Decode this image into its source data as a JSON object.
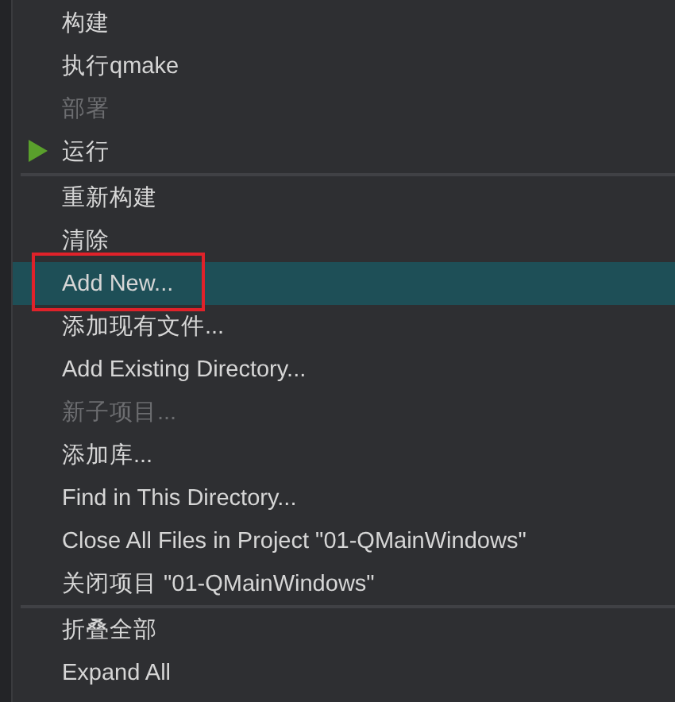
{
  "menu": {
    "groups": [
      {
        "items": [
          {
            "label": "构建",
            "disabled": false,
            "selected": false
          },
          {
            "label": "执行qmake",
            "disabled": false,
            "selected": false
          },
          {
            "label": "部署",
            "disabled": true,
            "selected": false
          },
          {
            "label": "运行",
            "disabled": false,
            "selected": false,
            "kind": "play"
          }
        ]
      },
      {
        "items": [
          {
            "label": "重新构建",
            "disabled": false,
            "selected": false
          },
          {
            "label": "清除",
            "disabled": false,
            "selected": false
          },
          {
            "label": "Add New...",
            "disabled": false,
            "selected": true
          },
          {
            "label": "添加现有文件...",
            "disabled": false,
            "selected": false
          },
          {
            "label": "Add Existing Directory...",
            "disabled": false,
            "selected": false
          },
          {
            "label": "新子项目...",
            "disabled": true,
            "selected": false
          },
          {
            "label": "添加库...",
            "disabled": false,
            "selected": false
          },
          {
            "label": "Find in This Directory...",
            "disabled": false,
            "selected": false
          },
          {
            "label": "Close All Files in Project \"01-QMainWindows\"",
            "disabled": false,
            "selected": false
          },
          {
            "label": "关闭项目 \"01-QMainWindows\"",
            "disabled": false,
            "selected": false
          }
        ]
      },
      {
        "items": [
          {
            "label": "折叠全部",
            "disabled": false,
            "selected": false
          },
          {
            "label": "Expand All",
            "disabled": false,
            "selected": false
          }
        ]
      }
    ]
  }
}
